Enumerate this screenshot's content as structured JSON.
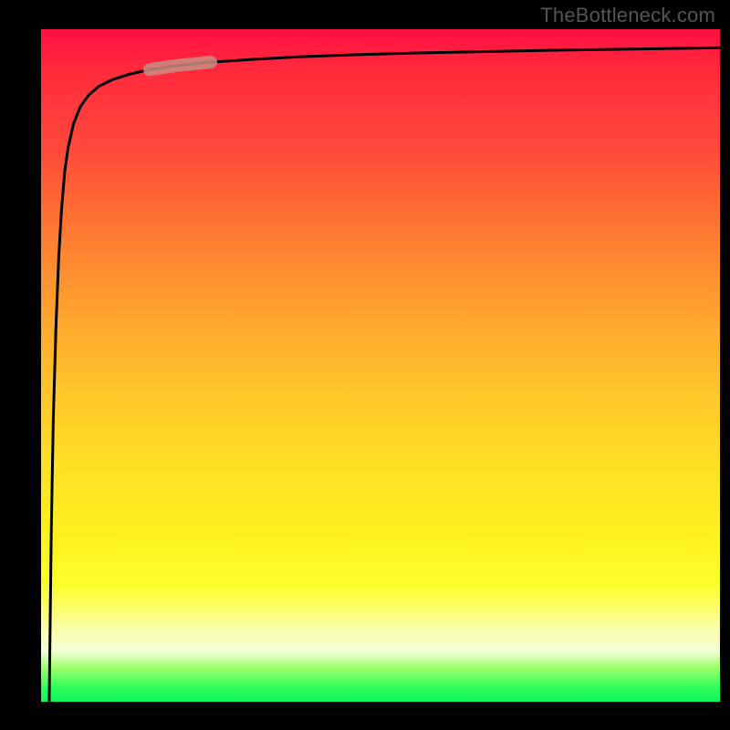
{
  "watermark": {
    "text": "TheBottleneck.com"
  },
  "colors": {
    "curve_stroke": "#000000",
    "highlight_stroke": "#c98c82",
    "background": "#000000"
  },
  "chart_data": {
    "type": "line",
    "title": "",
    "xlabel": "",
    "ylabel": "",
    "xlim": [
      0,
      100
    ],
    "ylim": [
      0,
      100
    ],
    "grid": false,
    "legend": false,
    "annotations": [
      {
        "text": "TheBottleneck.com",
        "position": "top-right"
      }
    ],
    "series": [
      {
        "name": "bottleneck-curve",
        "x": [
          1.2,
          1.5,
          1.8,
          2.2,
          2.6,
          3.0,
          3.5,
          4.0,
          4.8,
          5.8,
          7.0,
          8.5,
          10.5,
          13.0,
          16.0,
          20.0,
          25.0,
          31.0,
          38.0,
          46.0,
          55.0,
          64.0,
          74.0,
          84.0,
          92.0,
          100.0
        ],
        "y": [
          0.0,
          25.0,
          42.0,
          56.0,
          66.0,
          73.0,
          79.0,
          82.5,
          86.0,
          88.5,
          90.2,
          91.5,
          92.5,
          93.3,
          94.0,
          94.6,
          95.1,
          95.5,
          95.9,
          96.2,
          96.45,
          96.65,
          96.85,
          97.0,
          97.12,
          97.25
        ]
      }
    ],
    "highlight_segment": {
      "series": "bottleneck-curve",
      "x_start": 16.0,
      "x_end": 25.0,
      "color": "#c98c82"
    }
  }
}
